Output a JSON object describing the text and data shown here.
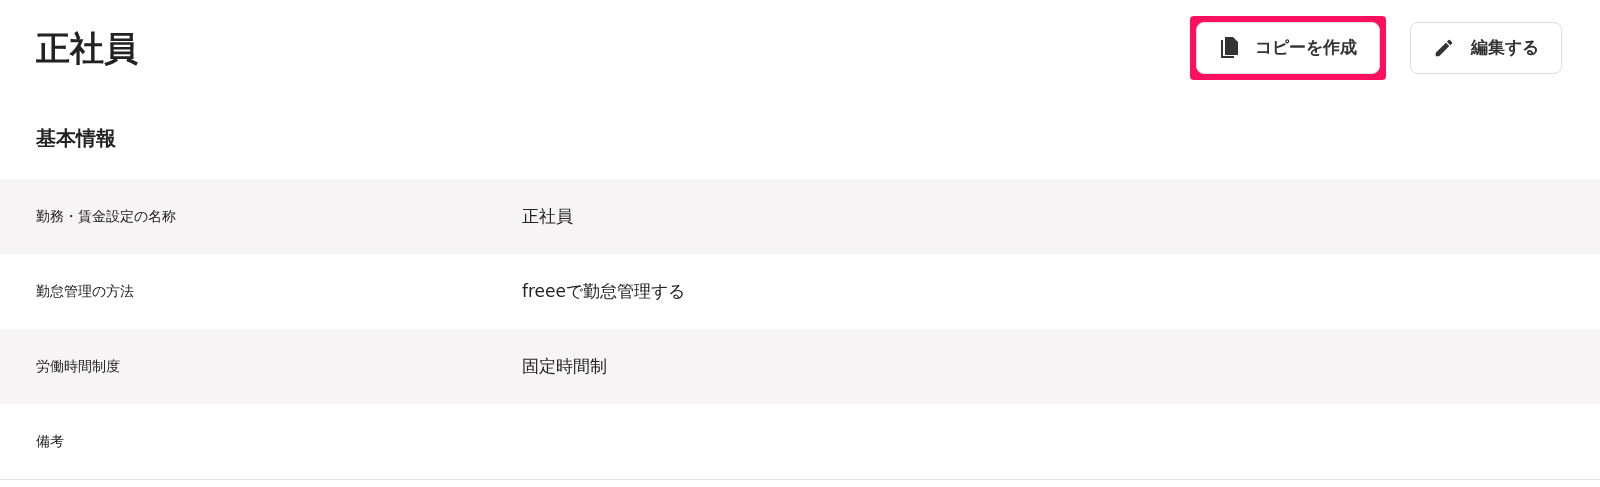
{
  "page": {
    "title": "正社員"
  },
  "actions": [
    {
      "kind": "copy",
      "label": "コピーを作成",
      "highlighted": true
    },
    {
      "kind": "edit",
      "label": "編集する",
      "highlighted": false
    }
  ],
  "section": {
    "title": "基本情報"
  },
  "rows": [
    {
      "label": "勤務・賃金設定の名称",
      "value": "正社員"
    },
    {
      "label": "勤怠管理の方法",
      "value": "freeeで勤怠管理する"
    },
    {
      "label": "労働時間制度",
      "value": "固定時間制"
    },
    {
      "label": "備考"
    }
  ]
}
